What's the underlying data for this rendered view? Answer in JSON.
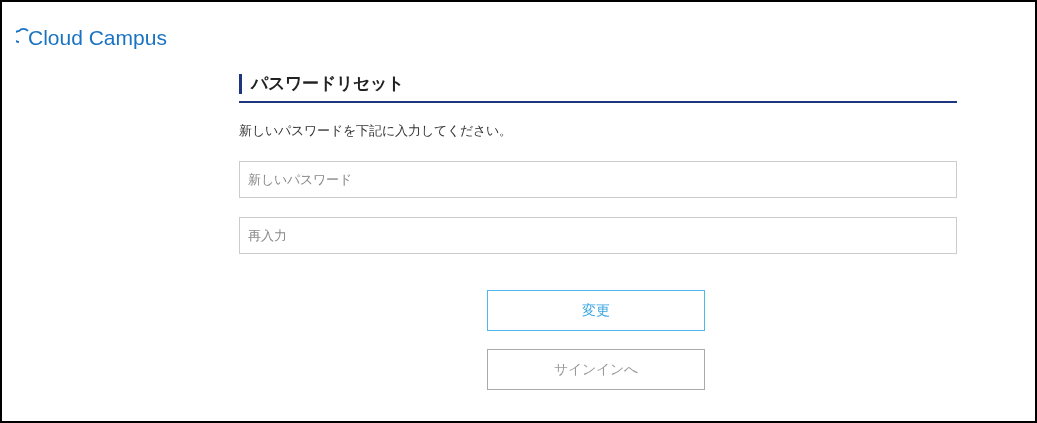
{
  "logo": {
    "text": "Cloud Campus"
  },
  "heading": "パスワードリセット",
  "instruction": "新しいパスワードを下記に入力してください。",
  "fields": [
    {
      "placeholder": "新しいパスワード"
    },
    {
      "placeholder": "再入力"
    }
  ],
  "buttons": [
    {
      "label": "変更",
      "kind": "primary"
    },
    {
      "label": "サインインへ",
      "kind": "secondary"
    }
  ]
}
